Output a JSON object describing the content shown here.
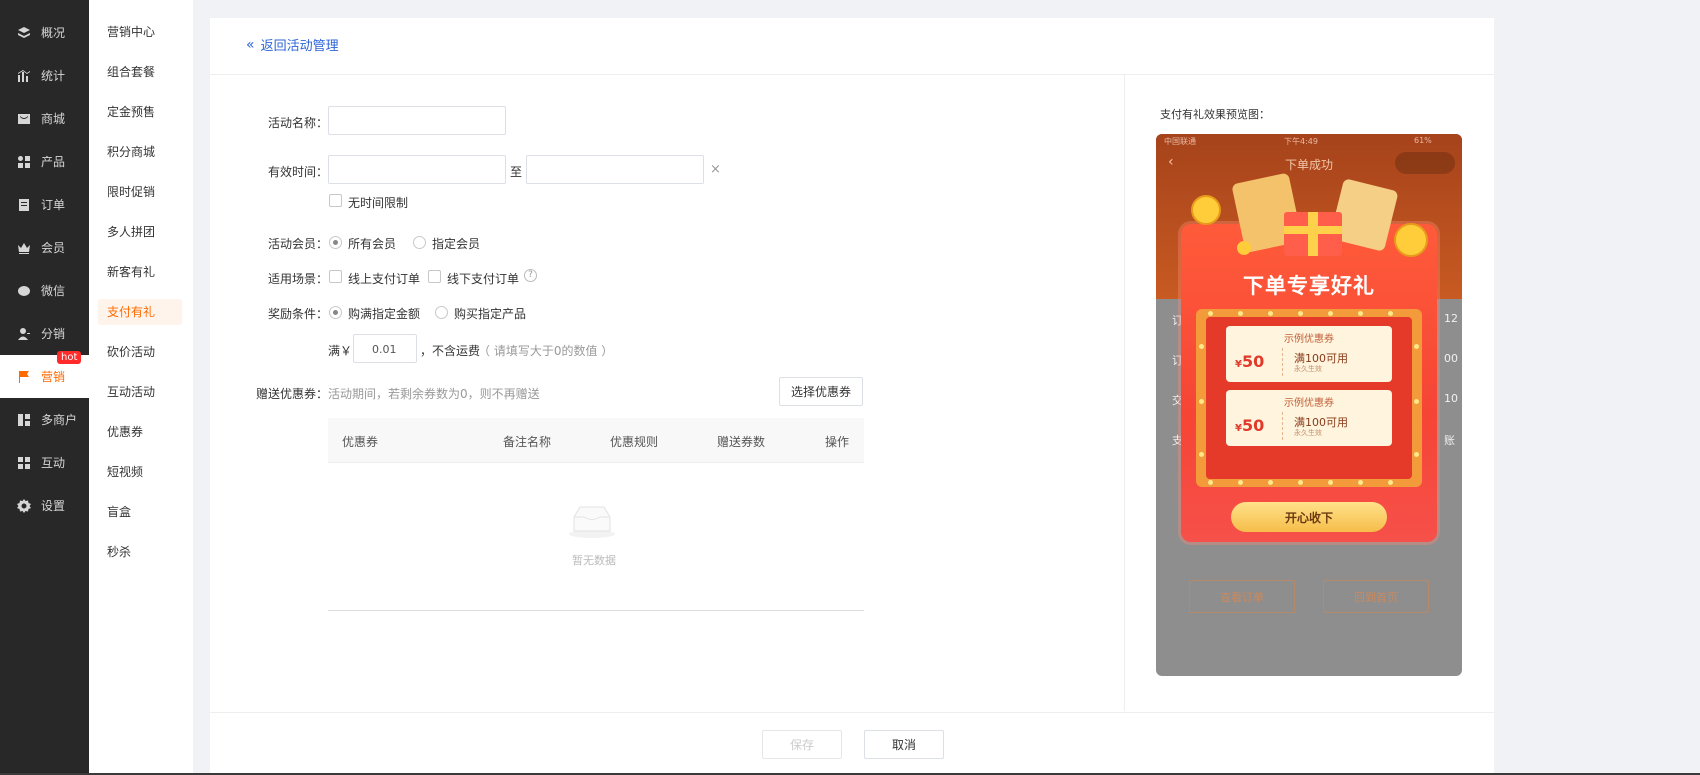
{
  "nav1": {
    "items": [
      {
        "label": "概况",
        "icon": "layers-icon"
      },
      {
        "label": "统计",
        "icon": "chart-icon"
      },
      {
        "label": "商城",
        "icon": "shop-icon"
      },
      {
        "label": "产品",
        "icon": "grid-icon"
      },
      {
        "label": "订单",
        "icon": "order-icon"
      },
      {
        "label": "会员",
        "icon": "crown-icon"
      },
      {
        "label": "微信",
        "icon": "wechat-icon"
      },
      {
        "label": "分销",
        "icon": "user-share-icon"
      },
      {
        "label": "营销",
        "icon": "flag-icon"
      },
      {
        "label": "多商户",
        "icon": "merchants-icon"
      },
      {
        "label": "互动",
        "icon": "interact-icon"
      },
      {
        "label": "设置",
        "icon": "gear-icon"
      }
    ],
    "hot_badge": "hot",
    "active_color": "#ff6a00"
  },
  "nav2": {
    "items": [
      "营销中心",
      "组合套餐",
      "定金预售",
      "积分商城",
      "限时促销",
      "多人拼团",
      "新客有礼",
      "支付有礼",
      "砍价活动",
      "互动活动",
      "优惠券",
      "短视频",
      "盲盒",
      "秒杀"
    ]
  },
  "page": {
    "back_label": "返回活动管理"
  },
  "form": {
    "name_label": "活动名称：",
    "time_label": "有效时间：",
    "time_to": "至",
    "time_clear": "×",
    "no_limit": "无时间限制",
    "member_label": "活动会员：",
    "member_all": "所有会员",
    "member_specific": "指定会员",
    "scene_label": "适用场景：",
    "scene_online": "线上支付订单",
    "scene_offline": "线下支付订单",
    "scene_help": "?",
    "cond_label": "奖励条件：",
    "cond_amount": "购满指定金额",
    "cond_product": "购买指定产品",
    "full_prefix": "满￥",
    "full_value": "0.01",
    "full_suffix": "，不含运费",
    "full_hint": "（ 请填写大于0的数值 ）",
    "coupon_label": "赠送优惠券：",
    "coupon_hint": "活动期间，若剩余券数为0，则不再赠送",
    "select_coupon": "选择优惠券"
  },
  "table": {
    "headers": [
      "优惠券",
      "备注名称",
      "优惠规则",
      "赠送券数",
      "操作"
    ],
    "empty": "暂无数据"
  },
  "footer": {
    "save": "保存",
    "cancel": "取消"
  },
  "preview": {
    "title": "支付有礼效果预览图：",
    "status_left": "中国联通",
    "status_time": "下午4:49",
    "status_right": "61%",
    "page_title": "下单成功",
    "headline": "下单专享好礼",
    "coupons": [
      {
        "title": "示例优惠券",
        "currency": "¥",
        "amount": "50",
        "rule": "满100可用",
        "sub": "永久生效"
      },
      {
        "title": "示例优惠券",
        "currency": "¥",
        "amount": "50",
        "rule": "满100可用",
        "sub": "永久生效"
      }
    ],
    "accept": "开心收下",
    "row_labels": [
      "订",
      "订",
      "交",
      "支"
    ],
    "row_values": [
      "12",
      "00",
      "10",
      "账"
    ],
    "view_order": "查看订单",
    "back_home": "回到首页"
  }
}
